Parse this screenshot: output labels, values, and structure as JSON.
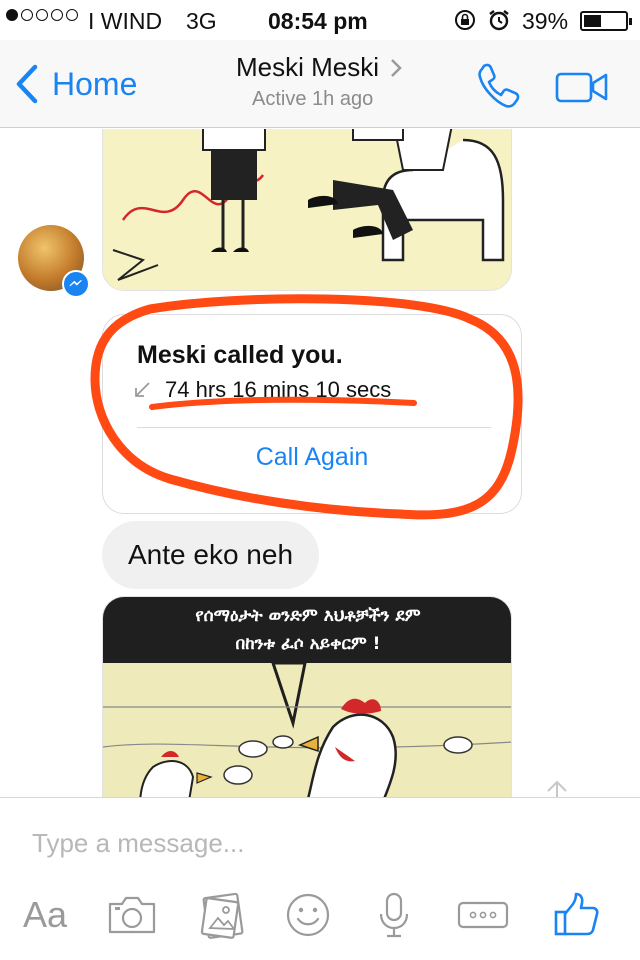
{
  "status_bar": {
    "carrier": "I WIND",
    "network": "3G",
    "time": "08:54 pm",
    "battery_percent_text": "39%",
    "battery_level": 0.39,
    "signal_dots_filled": 1,
    "signal_dots_total": 5
  },
  "nav": {
    "back_label": "Home",
    "title": "Meski Meski",
    "subtitle": "Active 1h ago",
    "accent_color": "#1a84f3"
  },
  "messages": {
    "call_card": {
      "title": "Meski called you.",
      "duration": "74 hrs 16 mins 10 secs",
      "action_label": "Call Again"
    },
    "text_message": "Ante eko neh",
    "comic_caption_line1": "የሰማዕታት ወንድም እህቶቻችን ደም",
    "comic_caption_line2": "በከንቱ ፈሶ አይቀርም !"
  },
  "composer": {
    "placeholder": "Type a message...",
    "aa_label": "Aa",
    "icons": [
      "aa-text-icon",
      "camera-icon",
      "gallery-icon",
      "emoji-icon",
      "microphone-icon",
      "more-icon",
      "like-icon"
    ]
  },
  "colors": {
    "annotation": "#ff4a14",
    "bubble_gray": "#f1f0f0",
    "accent": "#1a84f3"
  }
}
